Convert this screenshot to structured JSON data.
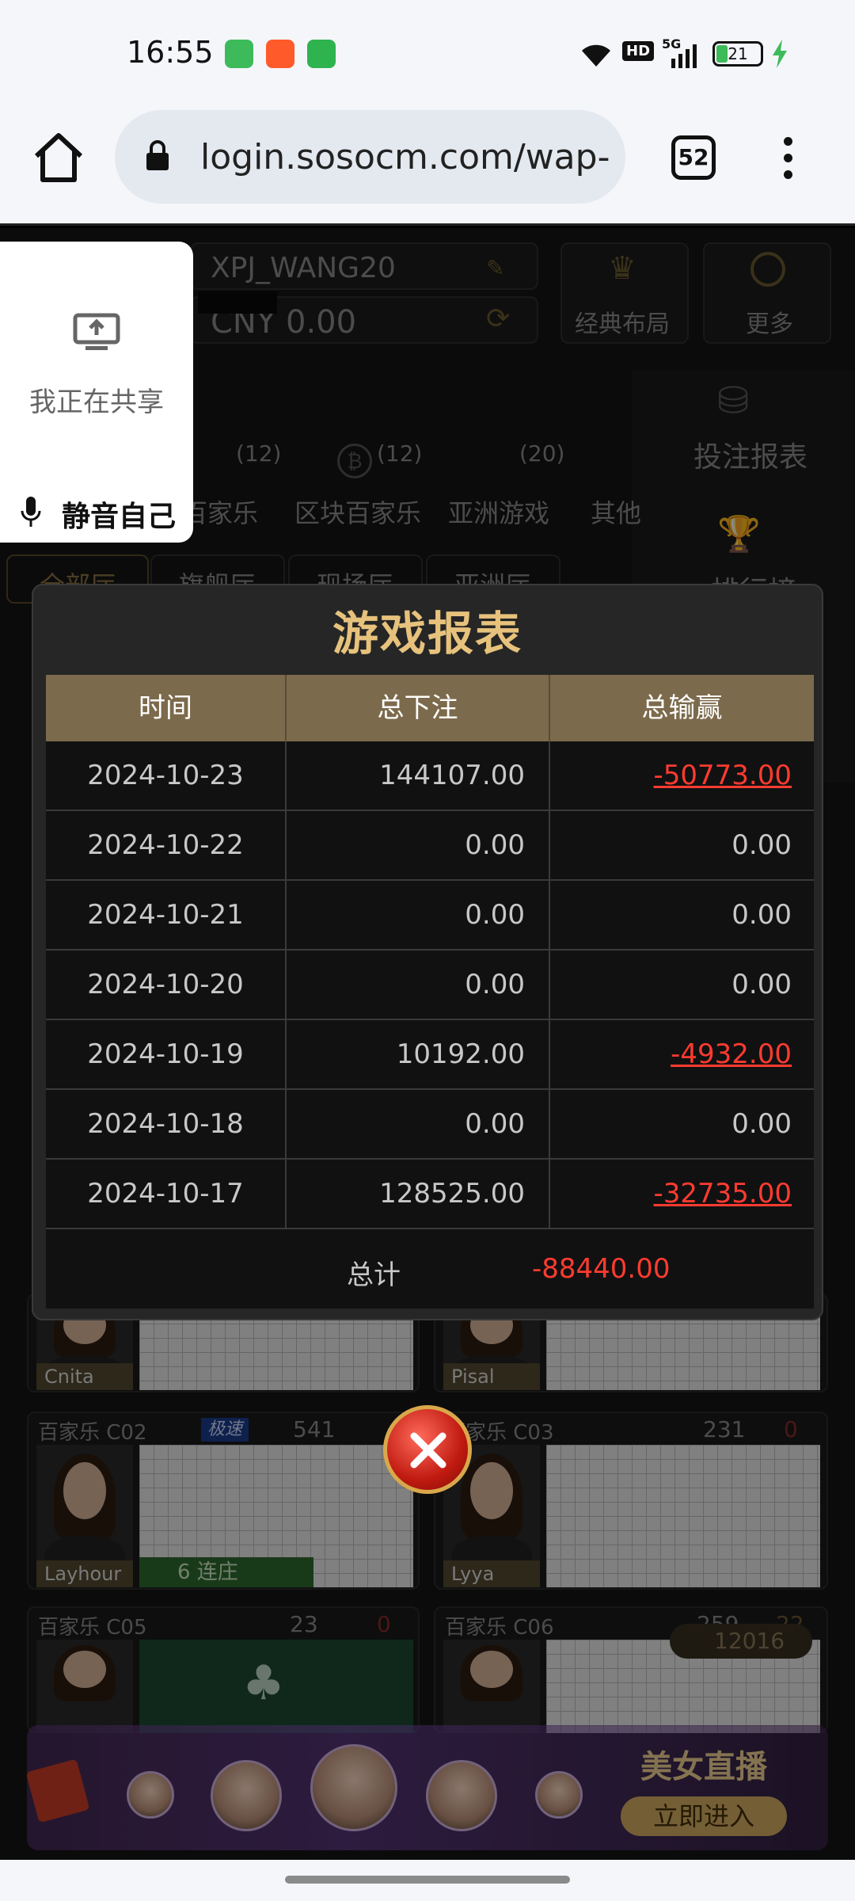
{
  "status_bar": {
    "time": "16:55",
    "network": "5G",
    "hd": "HD",
    "battery": "21"
  },
  "browser": {
    "url": "login.sosocm.com/wap-",
    "tab_count": "52"
  },
  "game_bg": {
    "username": "XPJ_WANG20",
    "balance": "CNY 0.00",
    "classic_layout": "经典布局",
    "more": "更多",
    "bet_report": "投注报表",
    "ranking": "排行榜",
    "categories": [
      {
        "label": "百家乐",
        "count": "(12)"
      },
      {
        "label": "区块百家乐",
        "count": "(12)"
      },
      {
        "label": "亚洲游戏",
        "count": "(20)"
      },
      {
        "label": "其他",
        "count": ""
      }
    ],
    "halls": [
      "全部厅",
      "旗舰厅",
      "现场厅",
      "亚洲厅"
    ],
    "tables": [
      {
        "name": "",
        "dealer": "Cnita"
      },
      {
        "name": "",
        "dealer": "Pisal"
      },
      {
        "name": "百家乐 C02",
        "dealer": "Layhour",
        "badge": "极速",
        "players": "541",
        "streak": "6 连庄"
      },
      {
        "name": "百家乐 C03",
        "dealer": "Lyya",
        "players": "231",
        "count": "0"
      },
      {
        "name": "百家乐 C05",
        "dealer": "",
        "players": "23",
        "count": "0"
      },
      {
        "name": "百家乐 C06",
        "dealer": "",
        "players": "259",
        "count": "22"
      }
    ],
    "online": "12016",
    "banner_title": "美女直播",
    "banner_button": "立即进入"
  },
  "share_widget": {
    "label": "我正在共享",
    "mute": "静音自己"
  },
  "modal": {
    "title": "游戏报表",
    "headers": [
      "时间",
      "总下注",
      "总输赢"
    ],
    "rows": [
      {
        "date": "2024-10-23",
        "bet": "144107.00",
        "win": "-50773.00"
      },
      {
        "date": "2024-10-22",
        "bet": "0.00",
        "win": "0.00"
      },
      {
        "date": "2024-10-21",
        "bet": "0.00",
        "win": "0.00"
      },
      {
        "date": "2024-10-20",
        "bet": "0.00",
        "win": "0.00"
      },
      {
        "date": "2024-10-19",
        "bet": "10192.00",
        "win": "-4932.00"
      },
      {
        "date": "2024-10-18",
        "bet": "0.00",
        "win": "0.00"
      },
      {
        "date": "2024-10-17",
        "bet": "128525.00",
        "win": "-32735.00"
      }
    ],
    "total_label": "总计",
    "total_value": "-88440.00"
  },
  "colors": {
    "accent_gold": "#e7c27c",
    "header_bg": "#7c6a4c",
    "negative": "#ff3b30"
  }
}
